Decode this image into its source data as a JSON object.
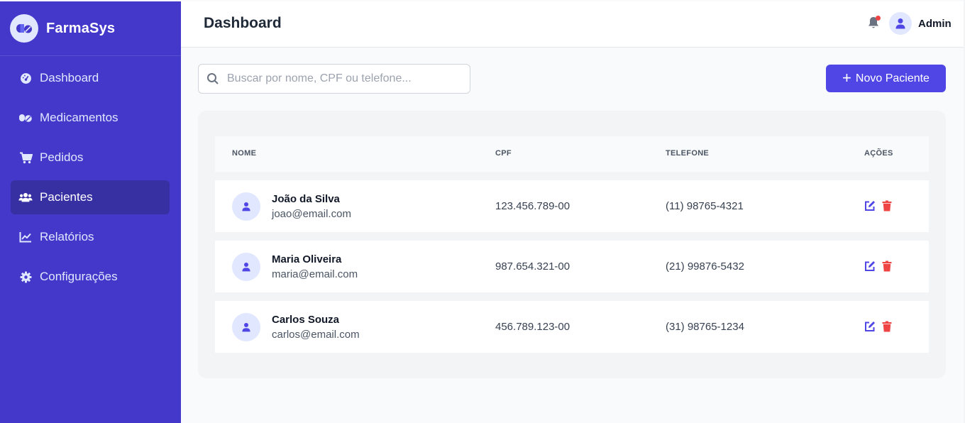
{
  "brand": {
    "name": "FarmaSys",
    "logo_icon": "pills-icon"
  },
  "sidebar": {
    "items": [
      {
        "label": "Dashboard",
        "icon": "gauge-icon",
        "active": false
      },
      {
        "label": "Medicamentos",
        "icon": "pills-icon",
        "active": false
      },
      {
        "label": "Pedidos",
        "icon": "cart-icon",
        "active": false
      },
      {
        "label": "Pacientes",
        "icon": "users-icon",
        "active": true
      },
      {
        "label": "Relatórios",
        "icon": "chart-line-icon",
        "active": false
      },
      {
        "label": "Configurações",
        "icon": "gear-icon",
        "active": false
      }
    ]
  },
  "header": {
    "title": "Dashboard",
    "user": "Admin",
    "notification_icon": "bell-icon"
  },
  "search": {
    "placeholder": "Buscar por nome, CPF ou telefone...",
    "value": ""
  },
  "actions": {
    "new_patient": "Novo Paciente"
  },
  "table": {
    "columns": [
      "NOME",
      "CPF",
      "TELEFONE",
      "AÇÕES"
    ],
    "rows": [
      {
        "name": "João da Silva",
        "email": "joao@email.com",
        "cpf": "123.456.789-00",
        "phone": "(11) 98765-4321"
      },
      {
        "name": "Maria Oliveira",
        "email": "maria@email.com",
        "cpf": "987.654.321-00",
        "phone": "(21) 99876-5432"
      },
      {
        "name": "Carlos Souza",
        "email": "carlos@email.com",
        "cpf": "456.789.123-00",
        "phone": "(31) 98765-1234"
      }
    ]
  },
  "colors": {
    "sidebar": "#4338ca",
    "accent": "#4f46e5",
    "danger": "#ef4444"
  }
}
